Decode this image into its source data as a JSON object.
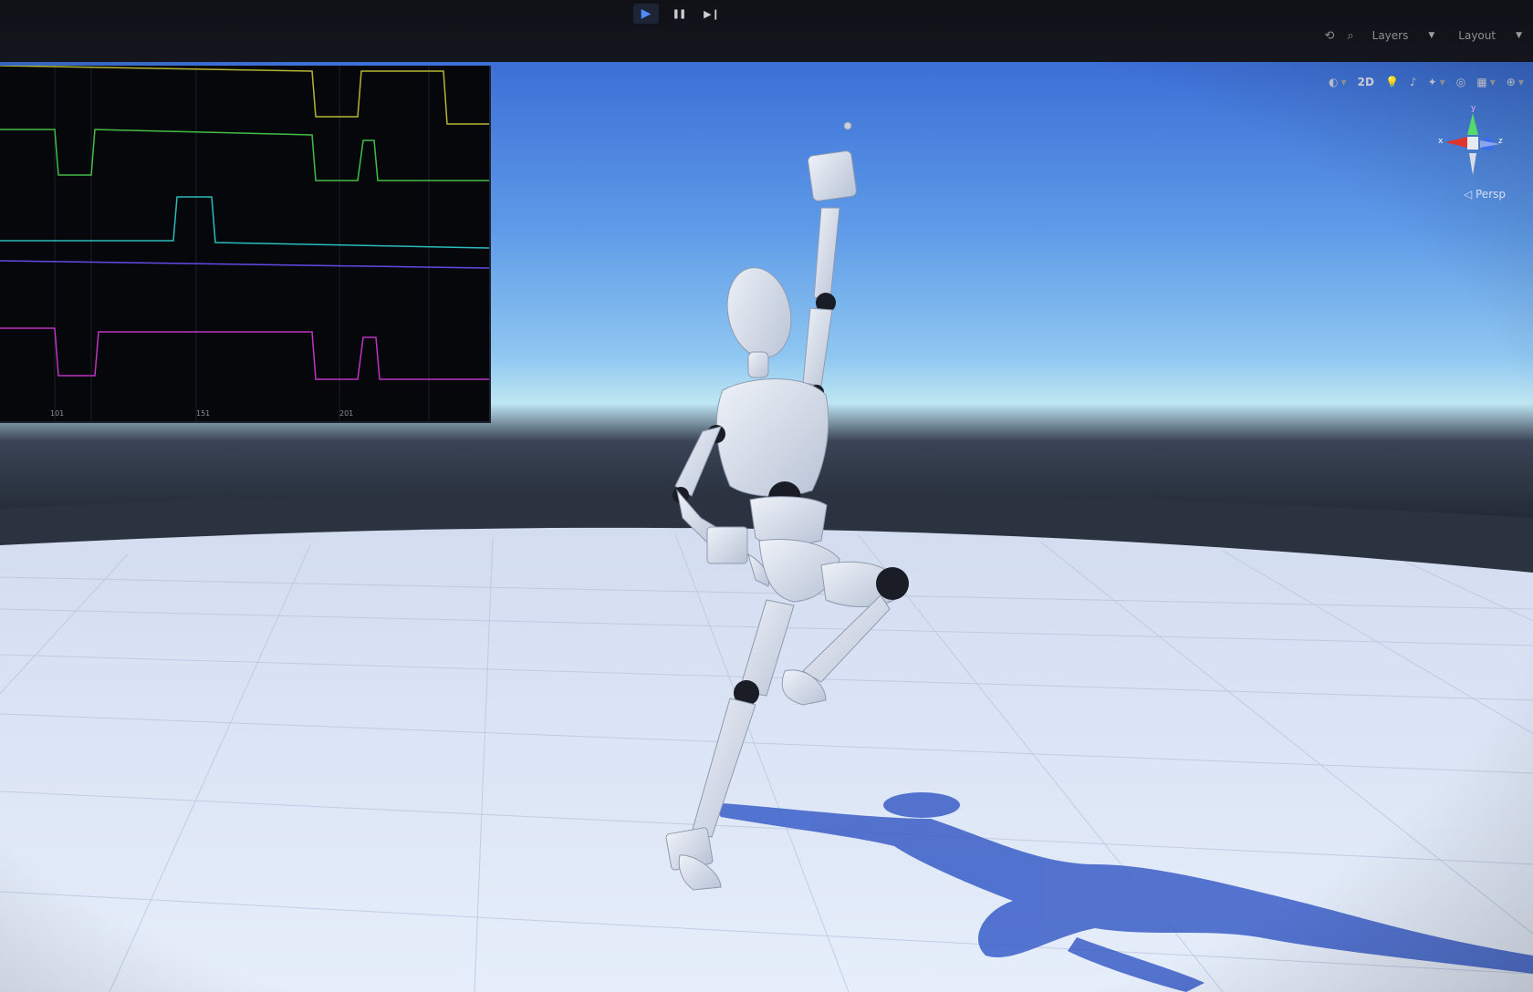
{
  "playbar": {
    "play_icon": "play-icon",
    "pause_icon": "pause-icon",
    "step_icon": "step-icon",
    "play_glyph": "▶",
    "pause_glyph": "❚❚",
    "step_glyph": "▶❙"
  },
  "top_right": {
    "history_icon": "history-icon",
    "search_icon": "search-icon",
    "layers_label": "Layers",
    "layout_label": "Layout"
  },
  "scene_toolbar": {
    "shading_icon": "shading-mode-icon",
    "label_2d": "2D",
    "lighting_icon": "lighting-toggle-icon",
    "audio_icon": "audio-toggle-icon",
    "effects_icon": "effects-icon",
    "hidden_icon": "visibility-icon",
    "grid_icon": "grid-icon",
    "gizmos_icon": "gizmos-icon"
  },
  "gizmo": {
    "x_label": "x",
    "y_label": "y",
    "z_label": "z",
    "persp_label": "◁ Persp"
  },
  "graph": {
    "series": [
      {
        "name": "",
        "color": "#c9c93a"
      },
      {
        "name": "",
        "color": "#4bd24b"
      },
      {
        "name": "",
        "color": "#2fd0d0"
      },
      {
        "name": "",
        "color": "#6a52ff"
      },
      {
        "name": "",
        "color": "#d43ad4"
      }
    ],
    "ticks": [
      "101",
      "151",
      "201"
    ]
  },
  "colors": {
    "sky_top": "#3f74db",
    "sky_mid": "#6aa6f0",
    "horizon": "#a9d9f2",
    "floor": "#dce6f5",
    "mannequin": "#dde3ee",
    "shadow": "#3b5fc4"
  }
}
